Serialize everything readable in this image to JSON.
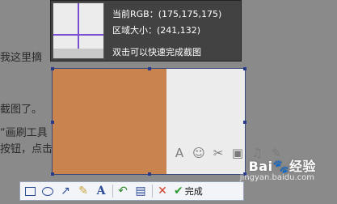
{
  "background": {
    "text_lines": [
      "我这里摘",
      "截图了。",
      "“画刷工具",
      "按钮，点击"
    ]
  },
  "info": {
    "rgb_label": "当前RGB：(175,175,175)",
    "size_label": "区域大小：(241,132)",
    "hint": "双击可以快速完成截图"
  },
  "toolbar": {
    "done_label": "完成",
    "icons": [
      "rectangle-icon",
      "ellipse-icon",
      "arrow-icon",
      "brush-icon",
      "text-icon",
      "undo-icon",
      "save-icon",
      "cancel-icon",
      "check-icon"
    ]
  },
  "watermark": {
    "text": "Bai🐾经验",
    "url": "jingyan.baidu.com"
  },
  "colors": {
    "selection_left": "#c8834e",
    "selection_right": "#ececec",
    "crosshair": "#7a4fd0",
    "accent": "#2b4c96"
  }
}
